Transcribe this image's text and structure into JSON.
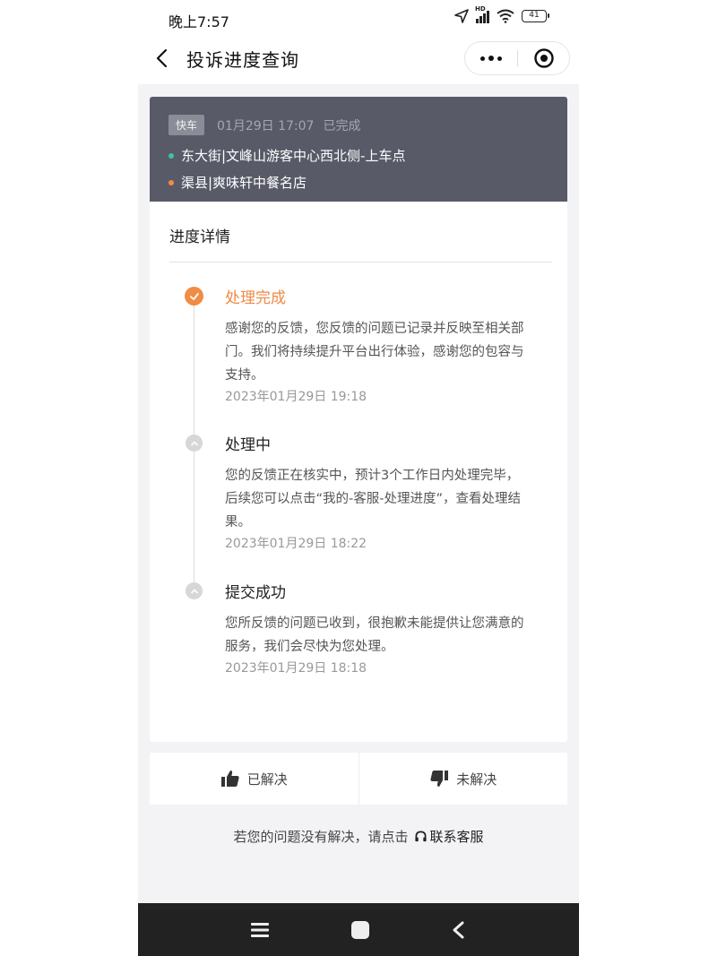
{
  "status_bar": {
    "time": "晚上7:57",
    "battery": "41",
    "network_label": "HD"
  },
  "nav": {
    "title": "投诉进度查询",
    "back_icon": "chevron-left-icon",
    "more_icon": "more-dots-icon",
    "close_icon": "target-circle-icon"
  },
  "order": {
    "tag": "快车",
    "datetime": "01月29日 17:07",
    "status": "已完成",
    "pickup": "东大街|文峰山游客中心西北侧-上车点",
    "dropoff": "渠县|爽味轩中餐名店",
    "pickup_dot_color": "#3ec3a9",
    "dropoff_dot_color": "#f28d44"
  },
  "progress": {
    "section_title": "进度详情",
    "steps": [
      {
        "title": "处理完成",
        "desc": "感谢您的反馈，您反馈的问题已记录并反映至相关部门。我们将持续提升平台出行体验，感谢您的包容与支持。",
        "time": "2023年01月29日 19:18"
      },
      {
        "title": "处理中",
        "desc": "您的反馈正在核实中，预计3个工作日内处理完毕，后续您可以点击“我的-客服-处理进度”，查看处理结果。",
        "time": "2023年01月29日 18:22"
      },
      {
        "title": "提交成功",
        "desc": "您所反馈的问题已收到，很抱歉未能提供让您满意的服务，我们会尽快为您处理。",
        "time": "2023年01月29日 18:18"
      }
    ]
  },
  "actions": {
    "resolved": "已解决",
    "unresolved": "未解决"
  },
  "help": {
    "text": "若您的问题没有解决，请点击",
    "link": "联系客服"
  },
  "accent_color": "#f18c45"
}
